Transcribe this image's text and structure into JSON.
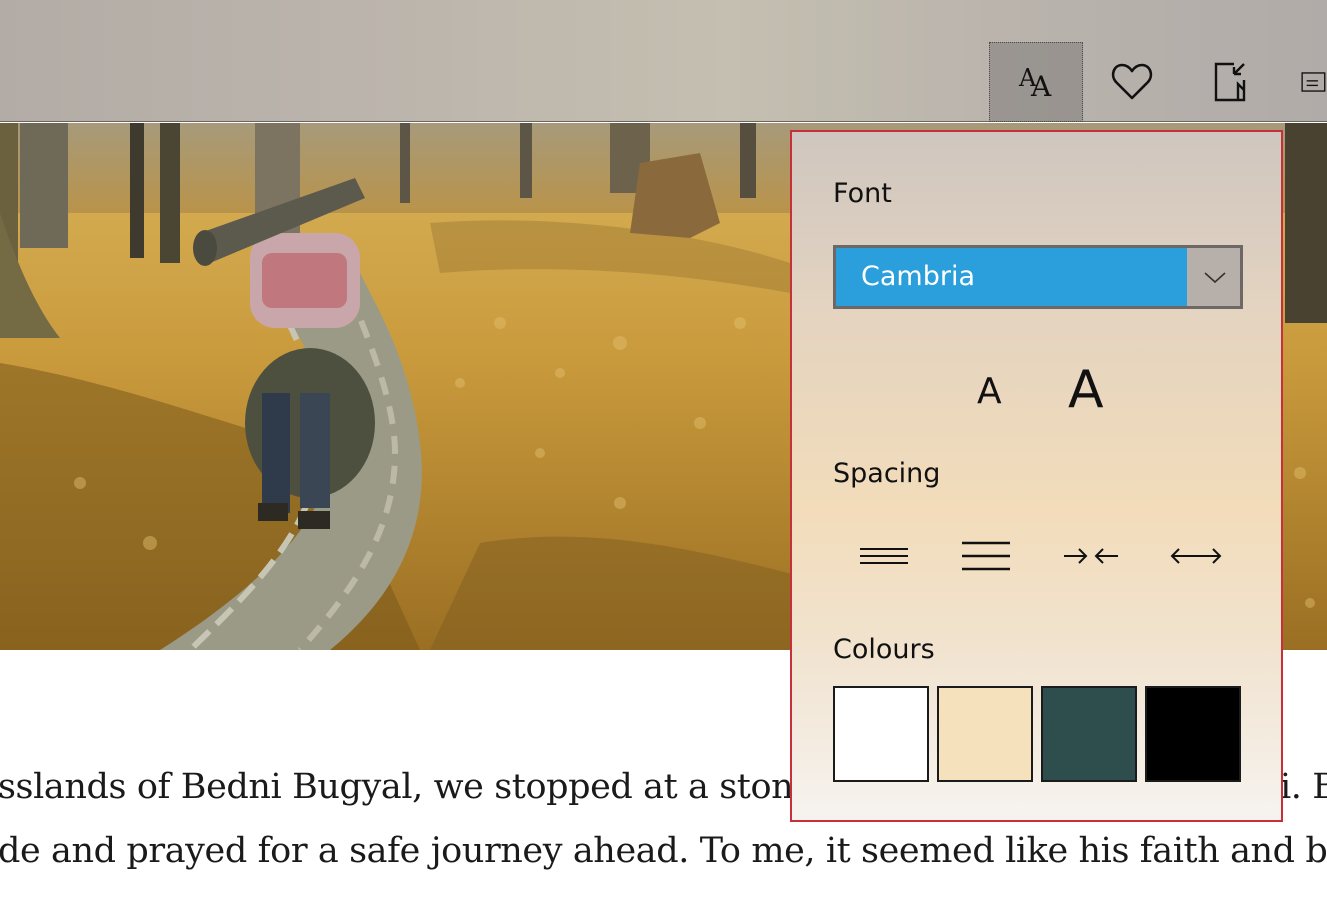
{
  "toolbar": {
    "buttons": [
      {
        "name": "text-options",
        "icon": "font-size-icon",
        "active": true
      },
      {
        "name": "favourite",
        "icon": "heart-icon",
        "active": false
      },
      {
        "name": "share",
        "icon": "share-icon",
        "active": false
      },
      {
        "name": "print",
        "icon": "printer-icon",
        "active": false
      }
    ]
  },
  "hero": {
    "icon": "forest-trail-photo"
  },
  "article": {
    "line1": "sslands of Bedni Bugyal, we stopped at a stone",
    "line1_tail": "i. B",
    "line2": "de and prayed for a safe journey ahead. To me, it seemed like his faith and beli"
  },
  "panel": {
    "font_label": "Font",
    "font_value": "Cambria",
    "size_small": "A",
    "size_large": "A",
    "spacing_label": "Spacing",
    "spacing_buttons": [
      {
        "icon": "narrow-line-spacing-icon"
      },
      {
        "icon": "wide-line-spacing-icon"
      },
      {
        "icon": "narrow-character-spacing-icon"
      },
      {
        "icon": "wide-character-spacing-icon"
      }
    ],
    "colours_label": "Colours",
    "colours": [
      "#ffffff",
      "#f5e1bc",
      "#2e4d4d",
      "#000000"
    ],
    "accent": "#2a9fdc",
    "border": "#c6303a"
  }
}
